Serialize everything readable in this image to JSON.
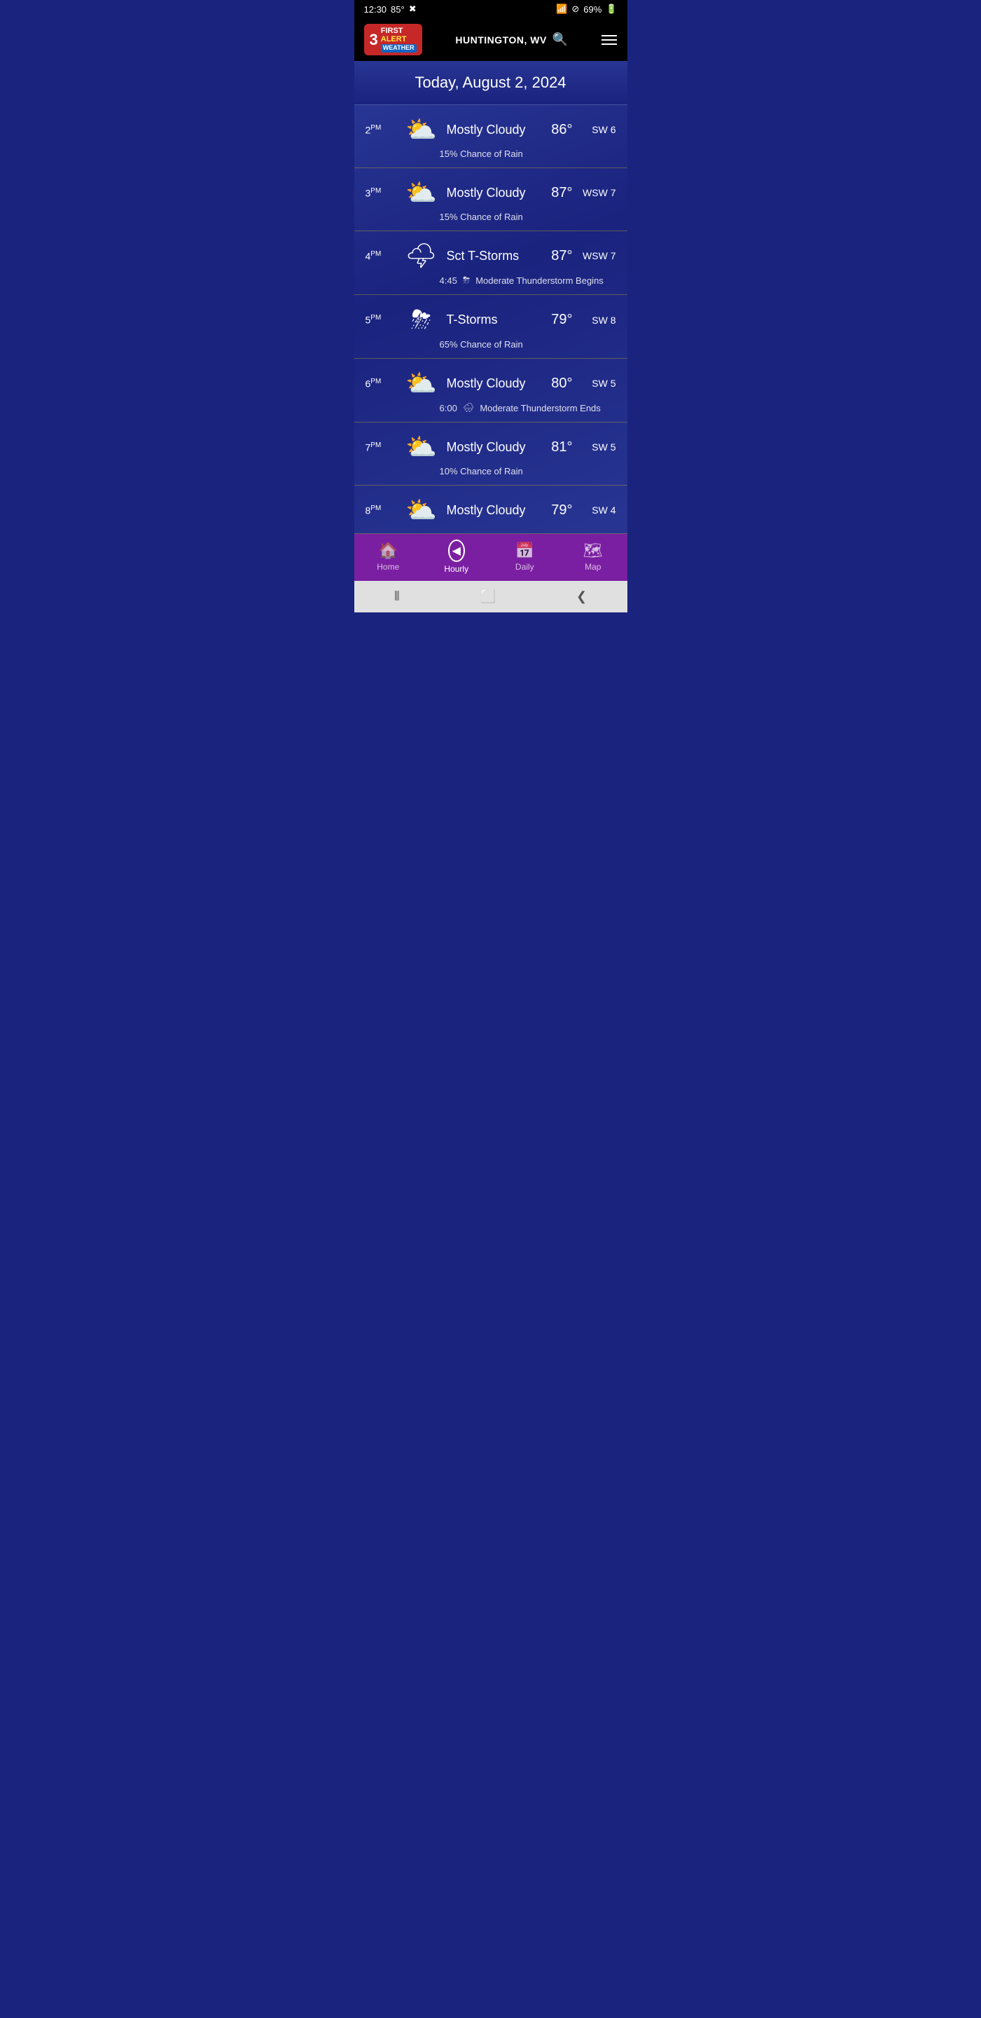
{
  "statusBar": {
    "time": "12:30",
    "temp": "85°",
    "wifi": true,
    "battery": "69%"
  },
  "header": {
    "logoNum": "3",
    "logoFirst": "FIRST",
    "logoAlert": "ALERT",
    "logoWeather": "WEATHER",
    "location": "HUNTINGTON, WV",
    "searchLabel": "search",
    "menuLabel": "menu"
  },
  "dateBanner": {
    "text": "Today, August 2, 2024"
  },
  "hourlyRows": [
    {
      "time": "2",
      "period": "PM",
      "icon": "⛅",
      "condition": "Mostly Cloudy",
      "temp": "86°",
      "wind": "SW 6",
      "sub": "15% Chance of Rain",
      "subIcon": ""
    },
    {
      "time": "3",
      "period": "PM",
      "icon": "⛅",
      "condition": "Mostly Cloudy",
      "temp": "87°",
      "wind": "WSW 7",
      "sub": "15% Chance of Rain",
      "subIcon": ""
    },
    {
      "time": "4",
      "period": "PM",
      "icon": "🌩",
      "condition": "Sct T-Storms",
      "temp": "87°",
      "wind": "WSW 7",
      "sub": "Moderate Thunderstorm Begins",
      "subTime": "4:45",
      "subIcon": "⛈"
    },
    {
      "time": "5",
      "period": "PM",
      "icon": "⛈",
      "condition": "T-Storms",
      "temp": "79°",
      "wind": "SW 8",
      "sub": "65% Chance of Rain",
      "subIcon": ""
    },
    {
      "time": "6",
      "period": "PM",
      "icon": "⛅",
      "condition": "Mostly Cloudy",
      "temp": "80°",
      "wind": "SW 5",
      "sub": "Moderate Thunderstorm Ends",
      "subTime": "6:00",
      "subIcon": "🌧"
    },
    {
      "time": "7",
      "period": "PM",
      "icon": "⛅",
      "condition": "Mostly Cloudy",
      "temp": "81°",
      "wind": "SW 5",
      "sub": "10% Chance of Rain",
      "subIcon": ""
    },
    {
      "time": "8",
      "period": "PM",
      "icon": "⛅",
      "condition": "Mostly Cloudy",
      "temp": "79°",
      "wind": "SW 4",
      "sub": "",
      "subIcon": ""
    }
  ],
  "bottomNav": {
    "items": [
      {
        "label": "Home",
        "icon": "🏠",
        "active": false
      },
      {
        "label": "Hourly",
        "icon": "◀",
        "active": true
      },
      {
        "label": "Daily",
        "icon": "📅",
        "active": false
      },
      {
        "label": "Map",
        "icon": "🗺",
        "active": false
      }
    ]
  },
  "androidNav": {
    "back": "❮",
    "home": "⬜",
    "recent": "⦀"
  }
}
